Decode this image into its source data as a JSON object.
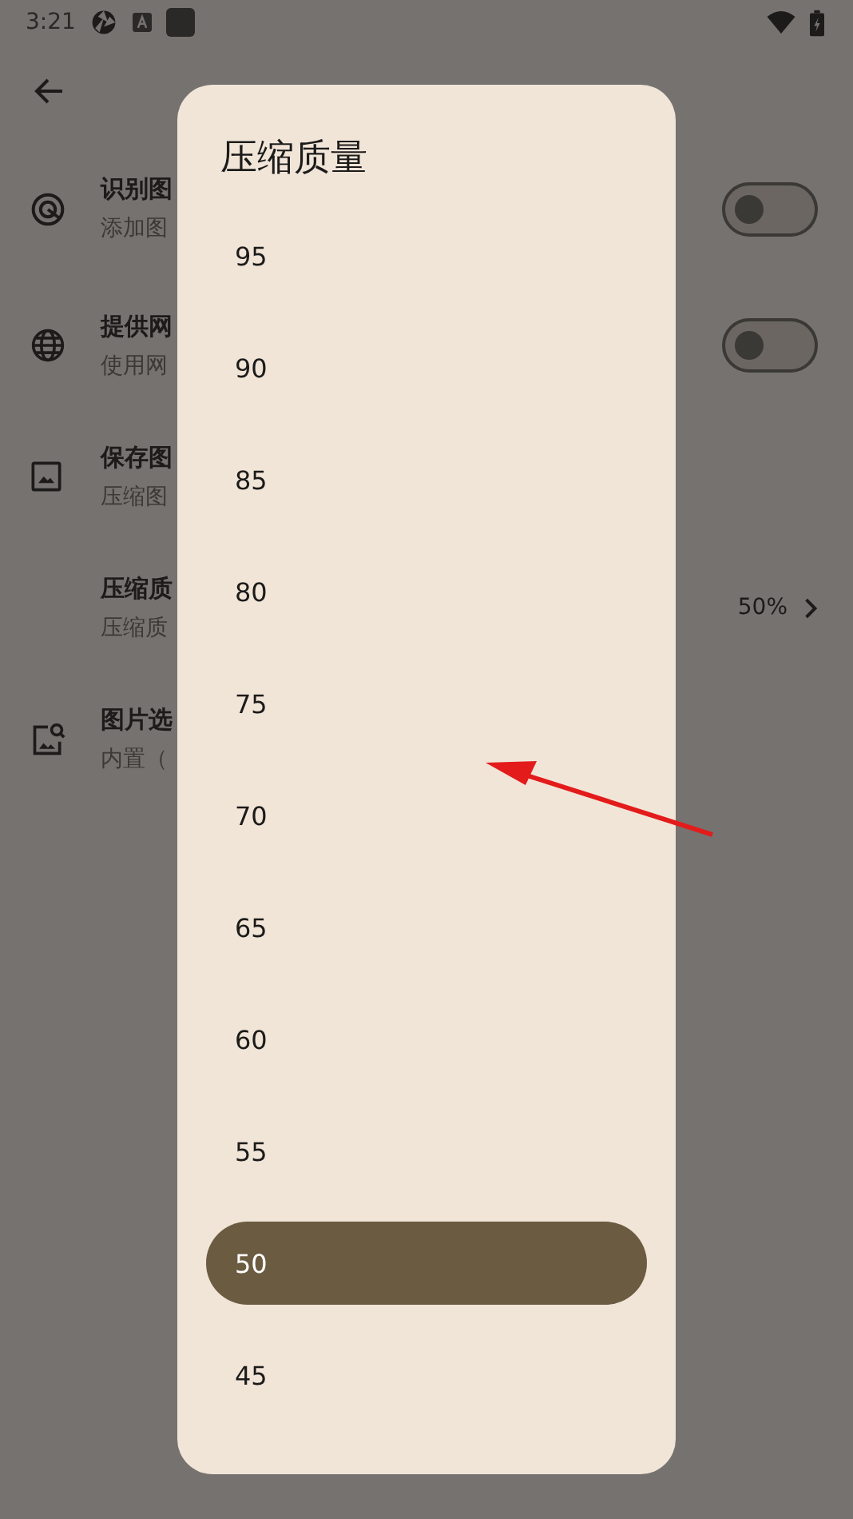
{
  "status_bar": {
    "time": "3:21"
  },
  "settings": [
    {
      "title": "识别图",
      "subtitle": "添加图",
      "kind": "switch",
      "on": false
    },
    {
      "title": "提供网",
      "subtitle": "使用网",
      "kind": "switch",
      "on": false
    },
    {
      "title": "保存图",
      "subtitle": "压缩图",
      "kind": "plain"
    },
    {
      "title": "压缩质",
      "subtitle": "压缩质",
      "kind": "value",
      "value": "50%"
    },
    {
      "title": "图片选",
      "subtitle": "内置（",
      "kind": "plain"
    }
  ],
  "dialog": {
    "title": "压缩质量",
    "options": [
      {
        "label": "95",
        "selected": false
      },
      {
        "label": "90",
        "selected": false
      },
      {
        "label": "85",
        "selected": false
      },
      {
        "label": "80",
        "selected": false
      },
      {
        "label": "75",
        "selected": false
      },
      {
        "label": "70",
        "selected": false
      },
      {
        "label": "65",
        "selected": false
      },
      {
        "label": "60",
        "selected": false
      },
      {
        "label": "55",
        "selected": false
      },
      {
        "label": "50",
        "selected": true
      },
      {
        "label": "45",
        "selected": false
      }
    ]
  },
  "annotation": {
    "kind": "arrow"
  }
}
